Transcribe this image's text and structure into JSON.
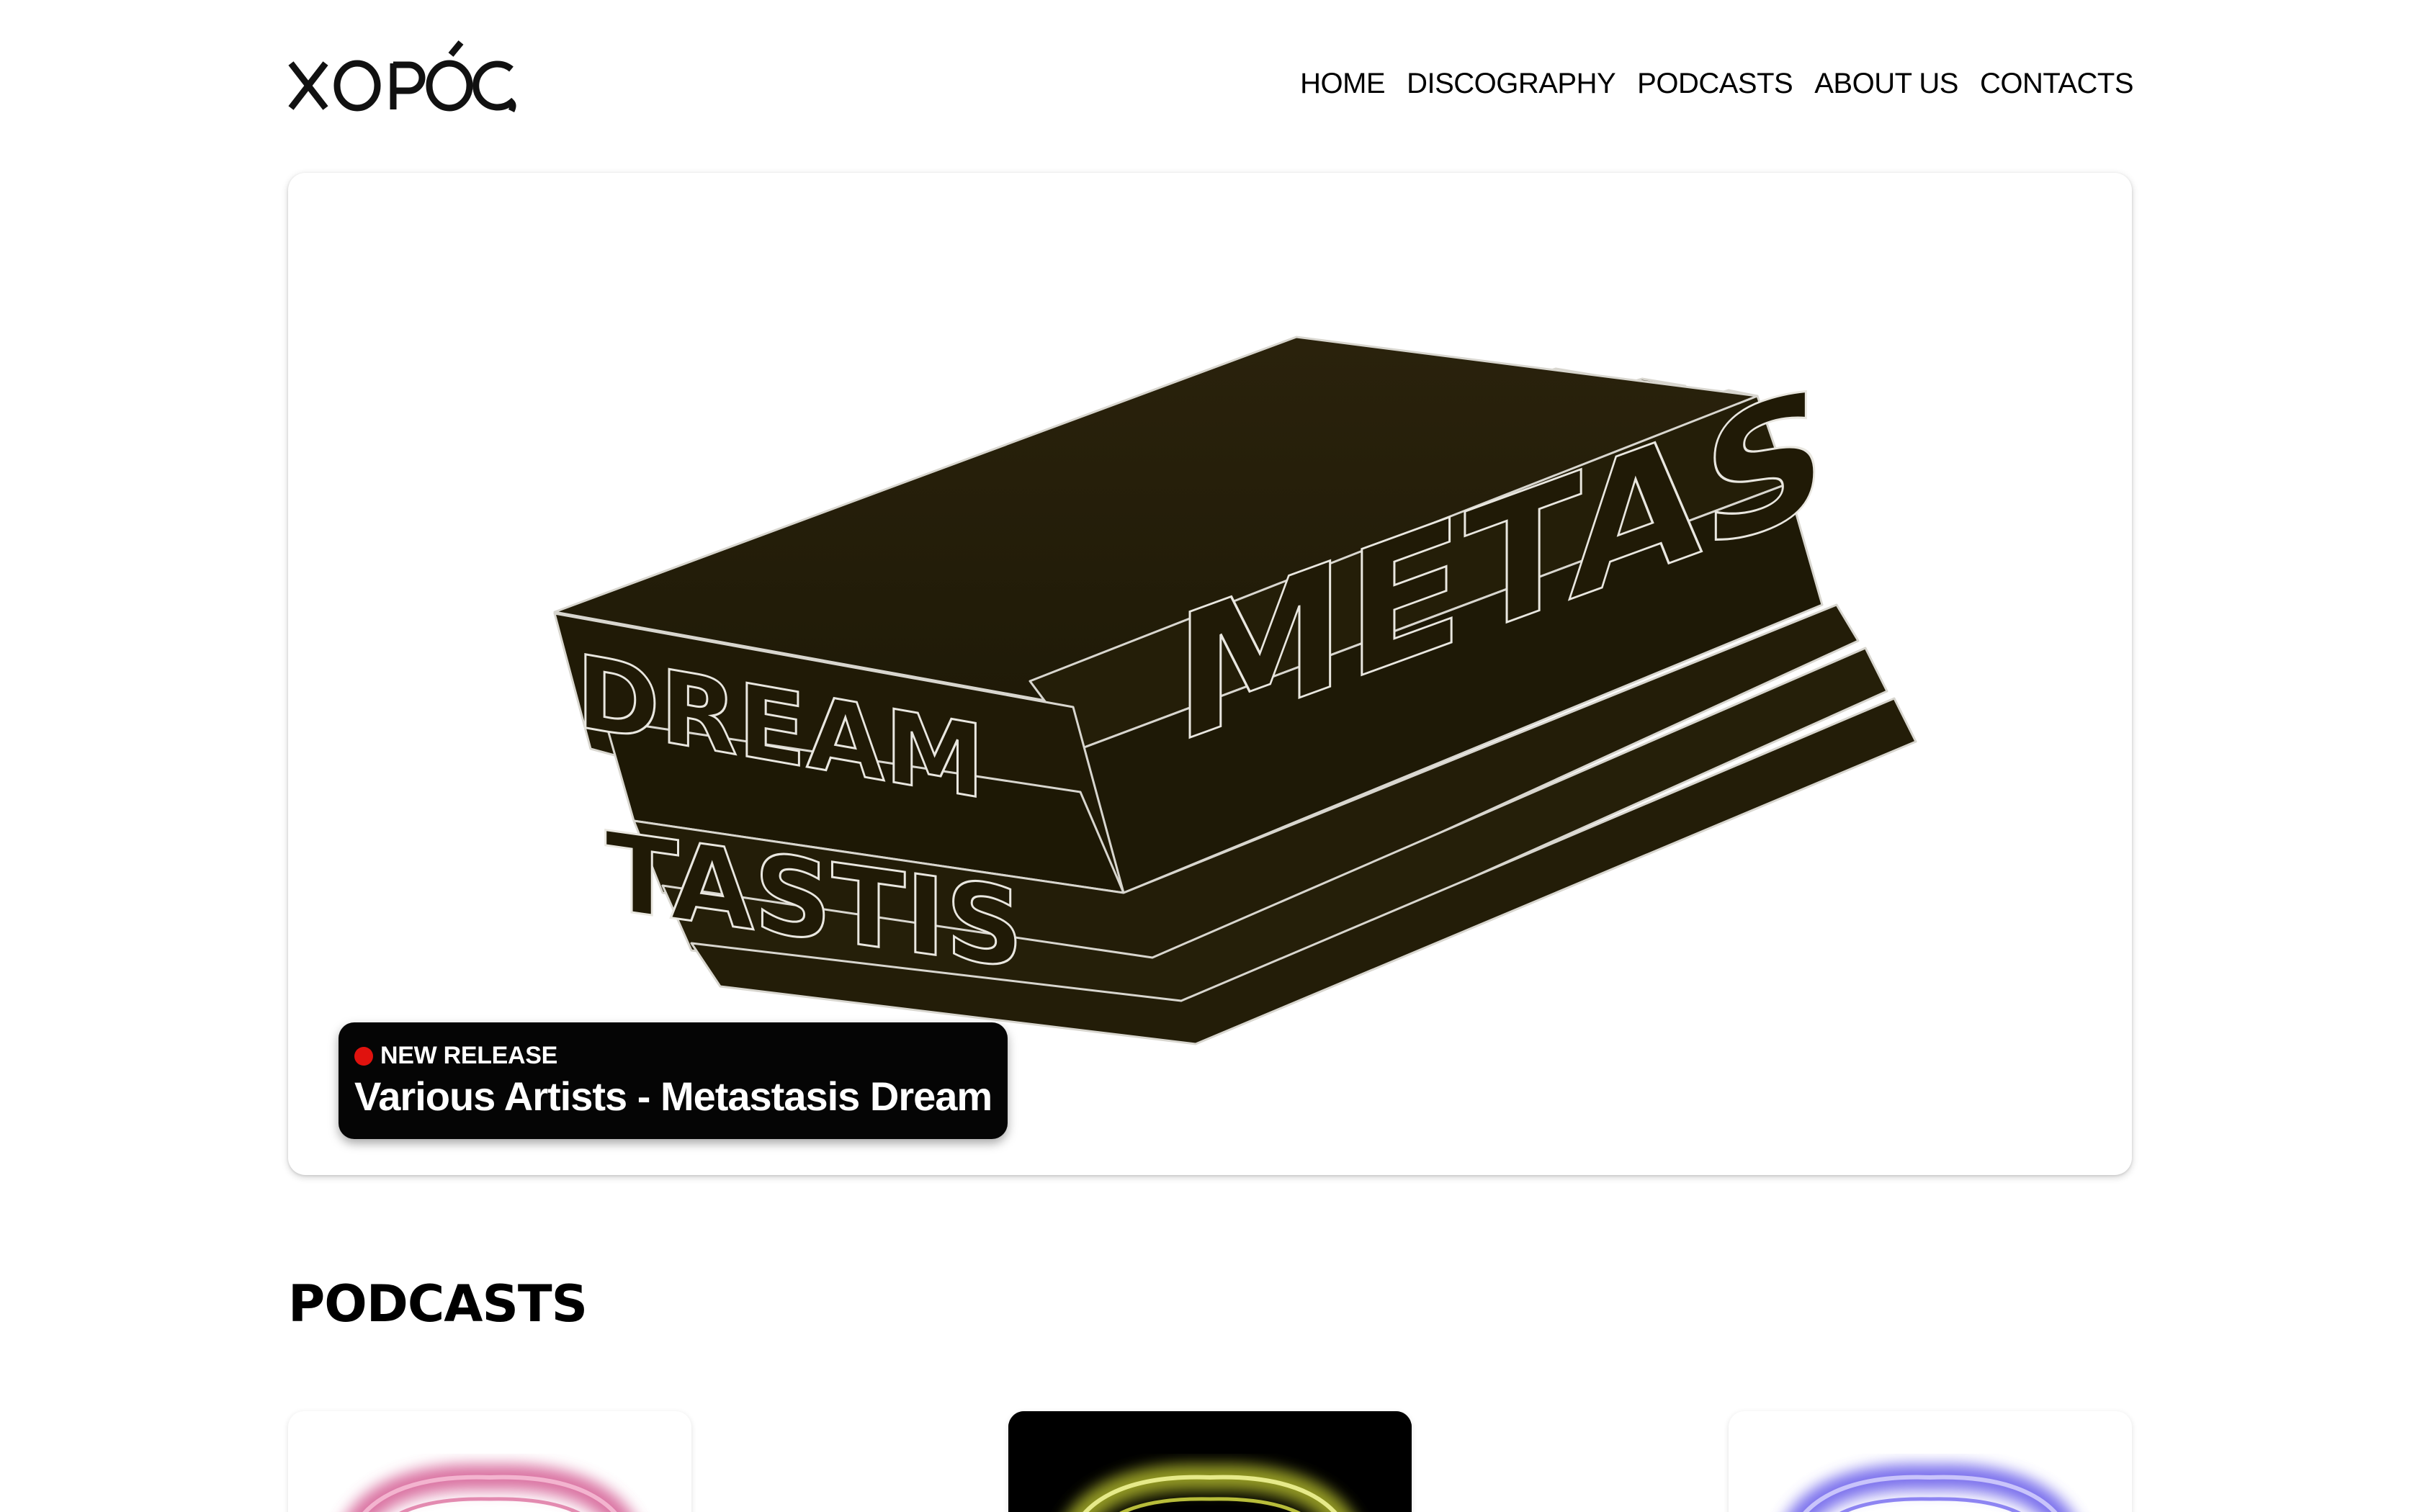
{
  "site": {
    "logo_text": "XOPÓϚ"
  },
  "nav": {
    "items": [
      {
        "label": "HOME"
      },
      {
        "label": "DISCOGRAPHY"
      },
      {
        "label": "PODCASTS"
      },
      {
        "label": "ABOUT US"
      },
      {
        "label": "CONTACTS"
      }
    ]
  },
  "hero": {
    "tag": "NEW RELEASE",
    "title": "Various Artists - Metastasis Dream",
    "artwork_text": "DREAM METASTASIS",
    "tag_dot_color": "#e0120e"
  },
  "podcasts": {
    "heading": "PODCASTS",
    "cards": [
      {
        "glow_color": "#d0508a",
        "background": "#ffffff"
      },
      {
        "glow_color": "#c8d030",
        "background": "#000000"
      },
      {
        "glow_color": "#5a4ee8",
        "background": "#ffffff"
      }
    ]
  }
}
